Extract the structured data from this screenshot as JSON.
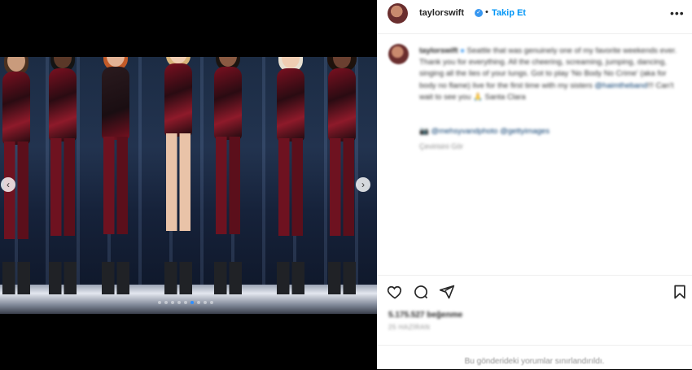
{
  "post": {
    "username": "taylorswift",
    "separator": "•",
    "follow_label": "Takip Et",
    "more_label": "•••"
  },
  "carousel": {
    "prev_label": "‹",
    "next_label": "›",
    "slide_count": 9,
    "active_slide": 6
  },
  "caption": {
    "username": "taylorswift",
    "text": "Seattle that was genuinely one of my favorite weekends ever. Thank you for everything. All the cheering, screaming, jumping, dancing, singing all the lies of your lungs. Got to play 'No Body No Crime' (aka for body no flame) live for the first time with my sisters ",
    "mention": "@haimtheband",
    "text_end": "!!! Can't wait to see you 🙏 Santa Clara",
    "credit": "📷 @mehsyvandphoto @gettyimages",
    "translate": "Çevirisini Gör"
  },
  "actions": {
    "like_icon": "heart-icon",
    "comment_icon": "comment-icon",
    "share_icon": "share-icon",
    "save_icon": "bookmark-icon"
  },
  "stats": {
    "likes": "5.175.527 beğenme",
    "date": "25 HAZİRAN"
  },
  "footer": {
    "comments_limited": "Bu gönderideki yorumlar sınırlandırıldı."
  },
  "colors": {
    "accent": "#0095f6",
    "verified": "#3897f0"
  }
}
